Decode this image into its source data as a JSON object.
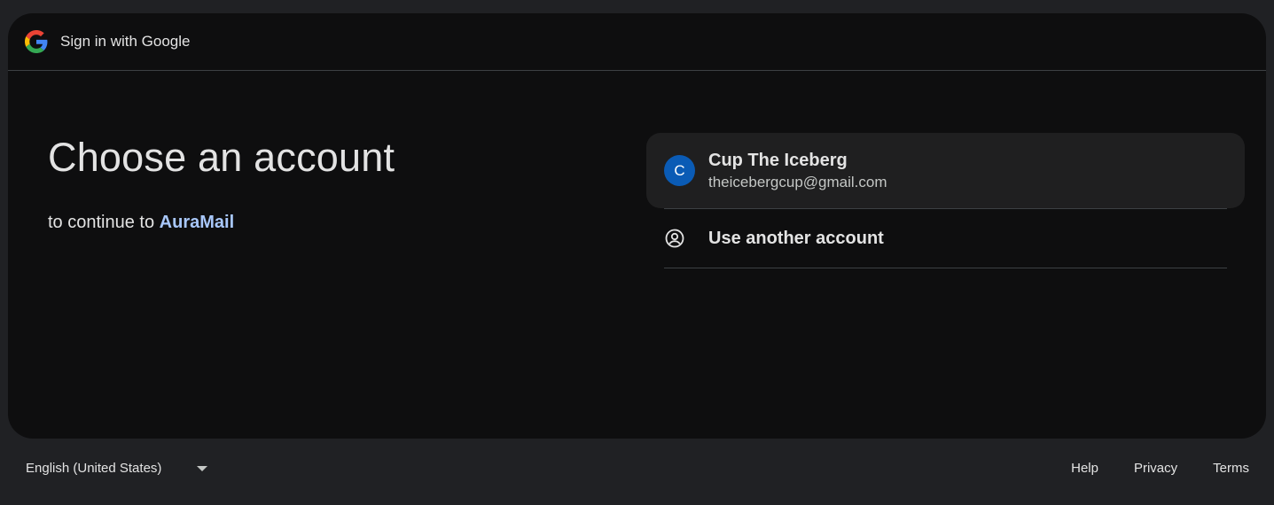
{
  "header": {
    "title": "Sign in with Google",
    "logo_icon": "google-g-icon"
  },
  "main": {
    "heading": "Choose an account",
    "subline_prefix": "to continue to",
    "app_name": "AuraMail"
  },
  "accounts": [
    {
      "avatar_initial": "C",
      "name": "Cup The Iceberg",
      "email": "theicebergcup@gmail.com",
      "avatar_color": "#0a5bb5"
    }
  ],
  "another_account": {
    "label": "Use another account",
    "icon": "person-circle-icon"
  },
  "footer": {
    "language": "English (United States)",
    "links": {
      "help": "Help",
      "privacy": "Privacy",
      "terms": "Terms"
    }
  },
  "colors": {
    "page_bg": "#202124",
    "card_bg": "#0e0e0f",
    "link": "#a8c7fa",
    "account_row_bg": "#1f1f20"
  }
}
